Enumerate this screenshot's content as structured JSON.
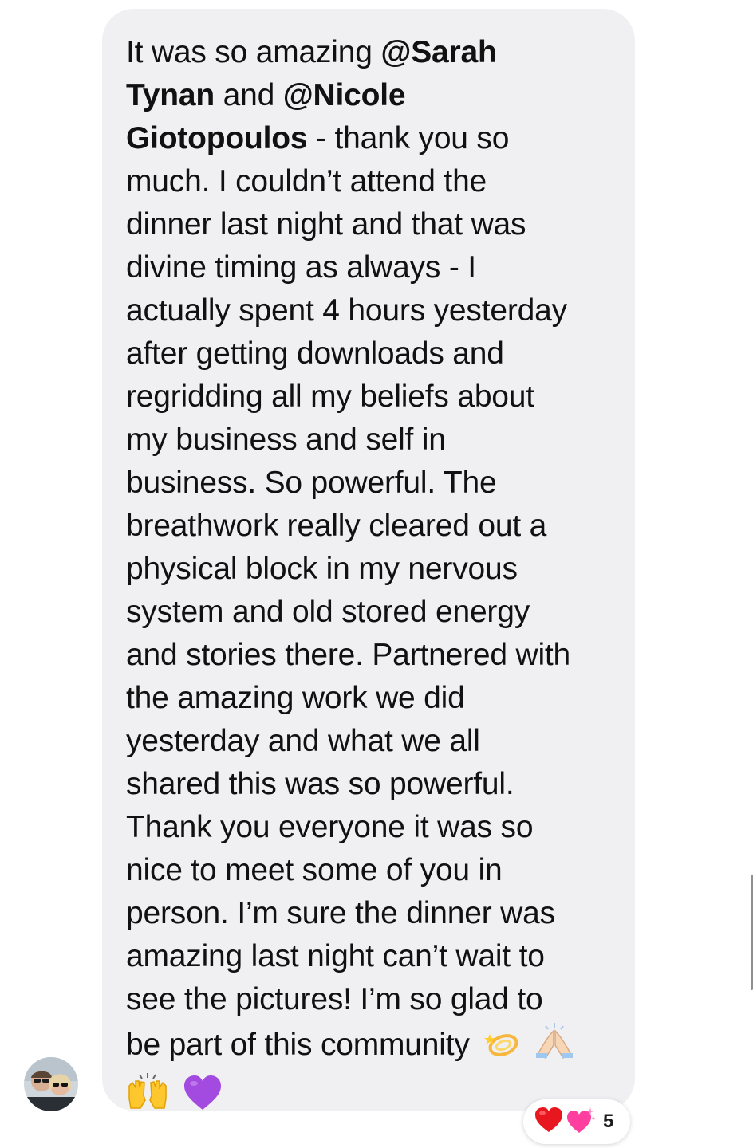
{
  "comment": {
    "line1": {
      "text": "It was so amazing ",
      "mention": "@Sarah"
    },
    "line2": {
      "mention": "Tynan",
      "text": " and ",
      "mention2": "@Nicole"
    },
    "line3": {
      "mention": "Giotopoulos",
      "text": " - thank you so"
    },
    "lines_plain": [
      "much. I couldn’t attend the",
      "dinner last night and that was",
      "divine timing as always - I",
      "actually spent 4 hours yesterday",
      "after getting downloads and",
      "regridding all my beliefs about",
      "my business and self in",
      "business. So powerful. The",
      "breathwork really cleared out a",
      "physical block in my nervous",
      "system and old stored energy",
      "and stories there. Partnered with",
      "the amazing work we did",
      "yesterday and what we all",
      "shared this was so powerful.",
      "Thank you everyone it was so",
      "nice to meet some of you in",
      "person. I’m sure the dinner was",
      "amazing last night can’t wait to",
      "see the pictures! I’m so glad to"
    ],
    "line_last": "be part of this community",
    "trailing_emojis": [
      "dizzy-emoji",
      "folded-hands-emoji",
      "raising-hands-emoji",
      "purple-heart-emoji"
    ]
  },
  "reactions": {
    "icons": [
      "red-heart-emoji",
      "sparkling-heart-emoji"
    ],
    "count": "5"
  },
  "colors": {
    "bubble_bg": "#f0f0f2",
    "text": "#111111"
  }
}
